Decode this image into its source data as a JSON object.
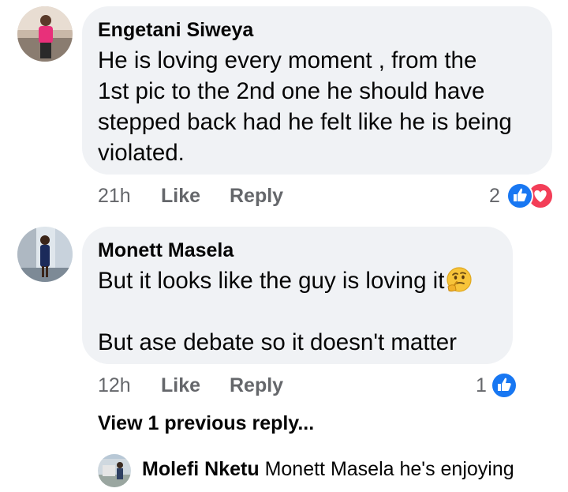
{
  "comments": [
    {
      "author": "Engetani Siweya",
      "text": "He is loving every moment , from the\n1st pic to the 2nd one he should have\nstepped back had he felt like he is being\nviolated.",
      "time": "21h",
      "like_label": "Like",
      "reply_label": "Reply",
      "reaction_count": "2",
      "reactions": [
        "like-icon",
        "love-icon"
      ]
    },
    {
      "author": "Monett Masela",
      "text_line1": "But it looks like the guy is loving it",
      "text_line2": "But ase debate so it doesn't matter",
      "emoji": "thinking-face-emoji",
      "time": "12h",
      "like_label": "Like",
      "reply_label": "Reply",
      "reaction_count": "1",
      "reactions": [
        "like-icon"
      ]
    }
  ],
  "view_previous": "View 1 previous reply...",
  "reply_preview": {
    "author": "Molefi Nketu",
    "text": "Monett Masela he's enjoying"
  },
  "colors": {
    "bubble": "#f0f2f5",
    "like_blue": "#1877f2",
    "love_red": "#f33e58",
    "meta_gray": "#65676b"
  }
}
